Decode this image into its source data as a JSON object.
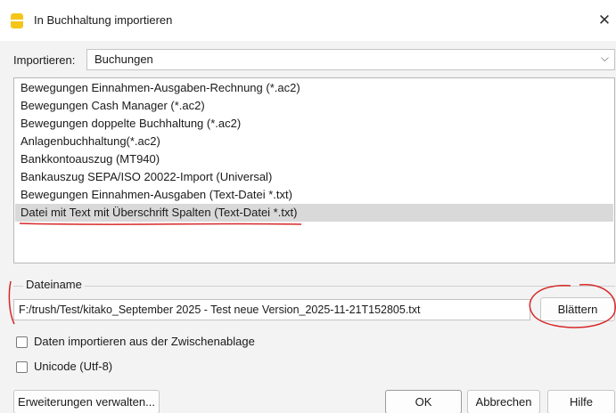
{
  "window": {
    "title": "In Buchhaltung importieren",
    "close_glyph": "✕",
    "app_icon": "banana-app-icon"
  },
  "import": {
    "label": "Importieren:",
    "value": "Buchungen"
  },
  "list": {
    "items": [
      "Bewegungen Einnahmen-Ausgaben-Rechnung (*.ac2)",
      "Bewegungen Cash Manager (*.ac2)",
      "Bewegungen doppelte Buchhaltung (*.ac2)",
      "Anlagenbuchhaltung(*.ac2)",
      "Bankkontoauszug (MT940)",
      "Bankauszug SEPA/ISO 20022-Import (Universal)",
      "Bewegungen Einnahmen-Ausgaben (Text-Datei *.txt)",
      "Datei mit Text mit Überschrift Spalten (Text-Datei *.txt)"
    ],
    "selected_index": 7
  },
  "file": {
    "legend": "Dateiname",
    "path": "F:/trush/Test/kitako_September 2025 - Test neue Version_2025-11-21T152805.txt",
    "browse_label": "Blättern"
  },
  "options": {
    "clipboard_label": "Daten importieren aus der Zwischenablage",
    "clipboard_checked": false,
    "unicode_label": "Unicode (Utf-8)",
    "unicode_checked": false
  },
  "footer": {
    "extensions_label": "Erweiterungen verwalten...",
    "ok_label": "OK",
    "cancel_label": "Abbrechen",
    "help_label": "Hilfe"
  },
  "colors": {
    "annotation_red": "#d62828",
    "selection_gray": "#d9d9d9",
    "icon_yellow": "#f5c518"
  }
}
